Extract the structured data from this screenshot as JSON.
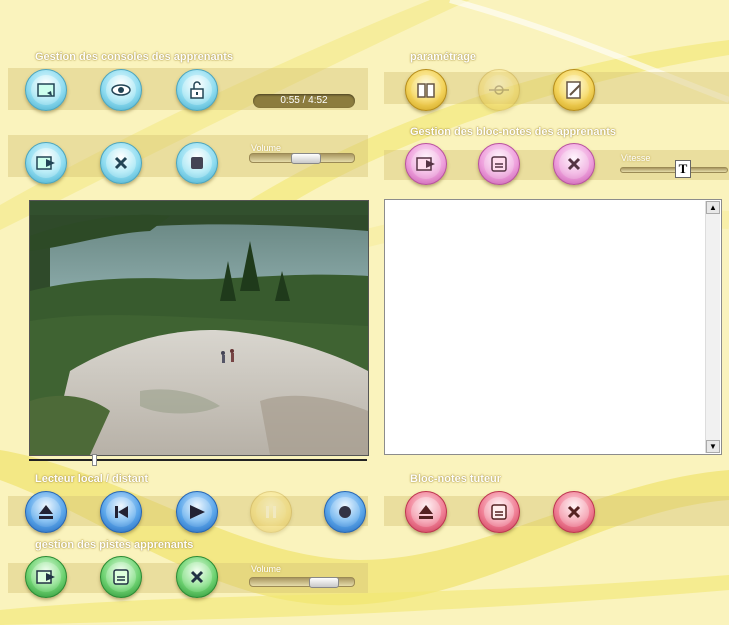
{
  "sections": {
    "consoles": "Gestion des consoles des apprenants",
    "parametrage": "paramétrage",
    "blocnotes": "Gestion des bloc-notes des apprenants",
    "lecteur": "Lecteur local / distant",
    "tuteur": "Bloc-notes tuteur",
    "pistes": "gestion des pistes apprenants"
  },
  "time_display": "0:55 / 4:52",
  "labels": {
    "volume_top": "Volume",
    "vitesse": "Vitesse",
    "volume_bottom": "Volume",
    "vitesse_thumb": "T"
  },
  "levels": {
    "volume_top": 0.55,
    "vitesse": 0.6,
    "volume_bottom": 0.8,
    "video_progress": 0.19
  },
  "scrollbar": {
    "up": "▲",
    "down": "▼"
  },
  "notes_text": "",
  "colors": {
    "background": "#faf3bd",
    "blue": "#8fdcf0",
    "gold": "#f3d35a",
    "pink": "#ee9fdc",
    "royal": "#5aa6ea",
    "red": "#f07f95",
    "green": "#6fd372"
  },
  "icons": {
    "consoles_row1": [
      "open-console-icon",
      "view-eye-icon",
      "unlock-icon"
    ],
    "consoles_row2": [
      "send-console-icon",
      "close-x-icon",
      "stop-square-icon"
    ],
    "parametrage": [
      "book-icon",
      "connect-icon",
      "edit-note-icon"
    ],
    "blocnotes": [
      "send-note-icon",
      "save-icon",
      "close-x-icon"
    ],
    "lecteur": [
      "eject-icon",
      "previous-icon",
      "play-icon",
      "pause-icon",
      "record-icon"
    ],
    "tuteur": [
      "eject-icon",
      "save-icon",
      "close-x-icon"
    ],
    "pistes": [
      "send-track-icon",
      "save-icon",
      "close-x-icon"
    ]
  }
}
